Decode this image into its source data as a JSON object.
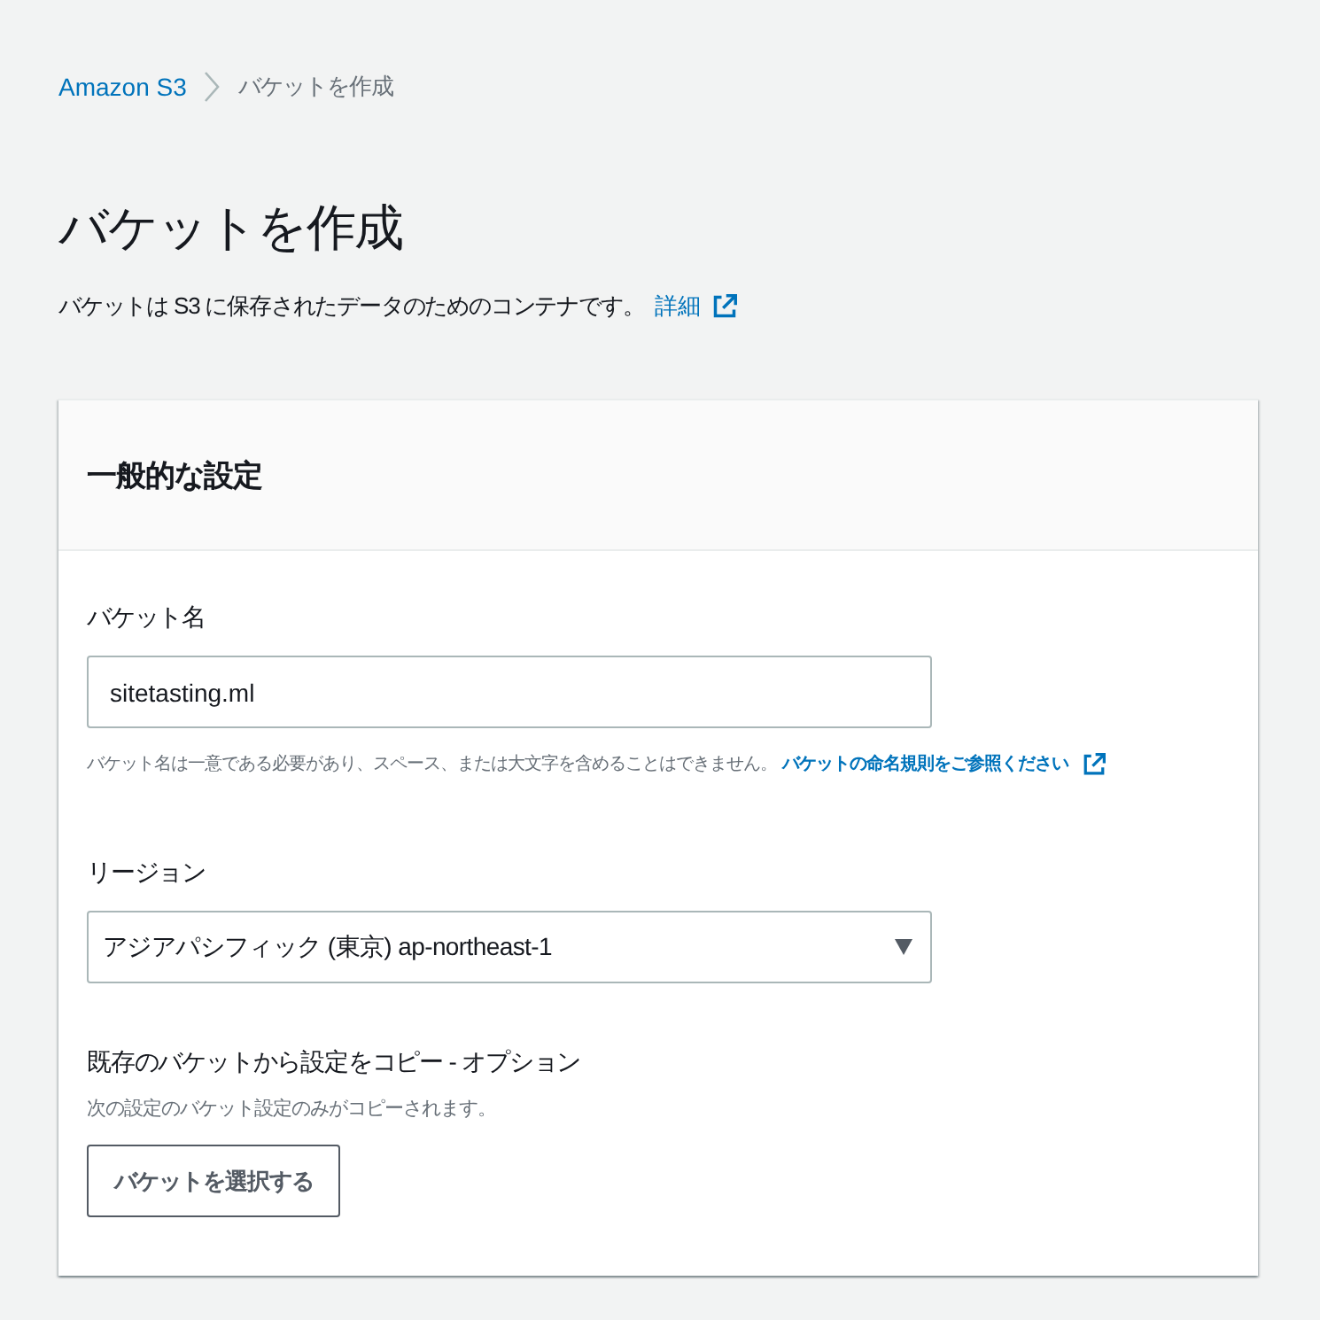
{
  "breadcrumb": [
    {
      "kind": "link",
      "label": "Amazon S3"
    },
    {
      "kind": "current",
      "label": "バケットを作成"
    }
  ],
  "header": {
    "title": "バケットを作成",
    "description": "バケットは S3 に保存されたデータのためのコンテナです。",
    "info_link": "詳細"
  },
  "panel": {
    "title": "一般的な設定",
    "fields": [
      {
        "kind": "text",
        "label": "バケット名",
        "value": "sitetasting.ml",
        "hint": "バケット名は一意である必要があり、スペース、または大文字を含めることはできません。",
        "hint_link": "バケットの命名規則をご参照ください"
      },
      {
        "kind": "select",
        "label": "リージョン",
        "value": "アジアパシフィック (東京) ap-northeast-1"
      },
      {
        "kind": "action",
        "label": "既存のバケットから設定をコピー - オプション",
        "description": "次の設定のバケット設定のみがコピーされます。",
        "button": "バケットを選択する"
      }
    ]
  }
}
